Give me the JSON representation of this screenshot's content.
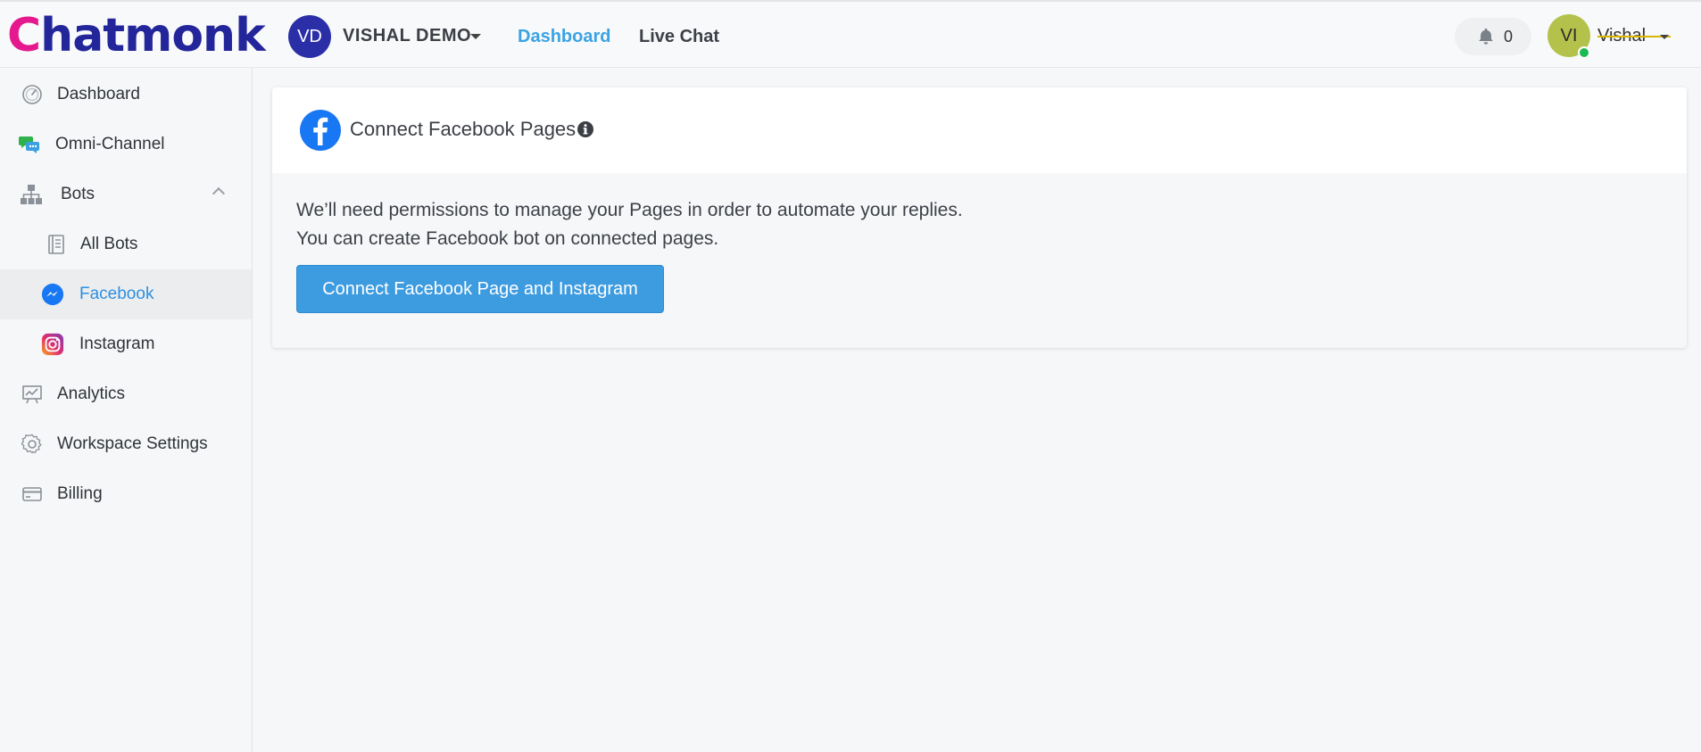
{
  "header": {
    "logo_text": "Chatmonk",
    "workspace": {
      "initials": "VD",
      "name": "VISHAL DEMO"
    },
    "nav": [
      {
        "label": "Dashboard",
        "active": true
      },
      {
        "label": "Live Chat",
        "active": false
      }
    ],
    "notifications": {
      "count": "0"
    },
    "user": {
      "initials": "VI",
      "name": "Vishal",
      "status": "online"
    }
  },
  "sidebar": {
    "items": [
      {
        "label": "Dashboard",
        "icon": "speedometer-icon"
      },
      {
        "label": "Omni-Channel",
        "icon": "chat-bubbles-icon"
      },
      {
        "label": "Bots",
        "icon": "sitemap-icon",
        "expanded": true
      },
      {
        "label": "All Bots",
        "icon": "book-icon"
      },
      {
        "label": "Facebook",
        "icon": "messenger-icon",
        "active": true
      },
      {
        "label": "Instagram",
        "icon": "instagram-icon"
      },
      {
        "label": "Analytics",
        "icon": "chart-board-icon"
      },
      {
        "label": "Workspace Settings",
        "icon": "gear-icon"
      },
      {
        "label": "Billing",
        "icon": "credit-card-icon"
      }
    ]
  },
  "main": {
    "card": {
      "title": "Connect Facebook Pages",
      "line1": "We’ll need permissions to manage your Pages in order to automate your replies.",
      "line2": "You can create Facebook bot on connected pages.",
      "button_label": "Connect Facebook Page and Instagram"
    }
  },
  "colors": {
    "brand_pink": "#e5198e",
    "brand_navy": "#23269a",
    "accent_blue": "#3d9be0",
    "facebook_blue": "#1877f2",
    "online_green": "#1db954"
  }
}
